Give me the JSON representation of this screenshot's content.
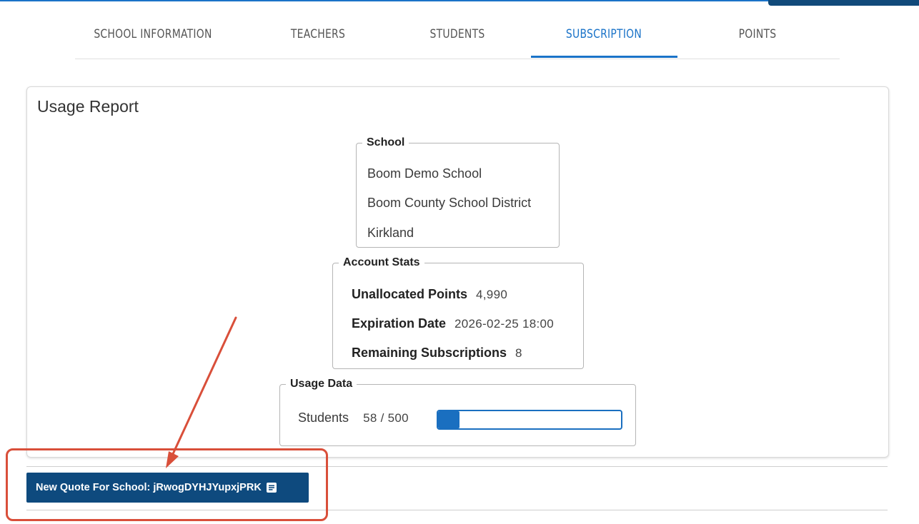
{
  "tabs": [
    {
      "label": "SCHOOL INFORMATION"
    },
    {
      "label": "TEACHERS"
    },
    {
      "label": "STUDENTS"
    },
    {
      "label": "SUBSCRIPTION"
    },
    {
      "label": "POINTS"
    }
  ],
  "active_tab": "SUBSCRIPTION",
  "report": {
    "title": "Usage Report",
    "school": {
      "legend": "School",
      "name": "Boom Demo School",
      "district": "Boom County School District",
      "city": "Kirkland"
    },
    "account_stats": {
      "legend": "Account Stats",
      "unallocated_label": "Unallocated Points",
      "unallocated_value": "4,990",
      "expiration_label": "Expiration Date",
      "expiration_value": "2026-02-25 18:00",
      "remaining_label": "Remaining Subscriptions",
      "remaining_value": "8"
    },
    "usage_data": {
      "legend": "Usage Data",
      "students_label": "Students",
      "students_value": "58 / 500",
      "students_fraction": 0.116
    }
  },
  "quote_button": {
    "label": "New Quote For School: jRwogDYHJYupxjPRK",
    "icon": "document-icon"
  },
  "colors": {
    "accent": "#1a73c8",
    "button": "#0e4a7e",
    "annotation": "#d94f3a"
  }
}
